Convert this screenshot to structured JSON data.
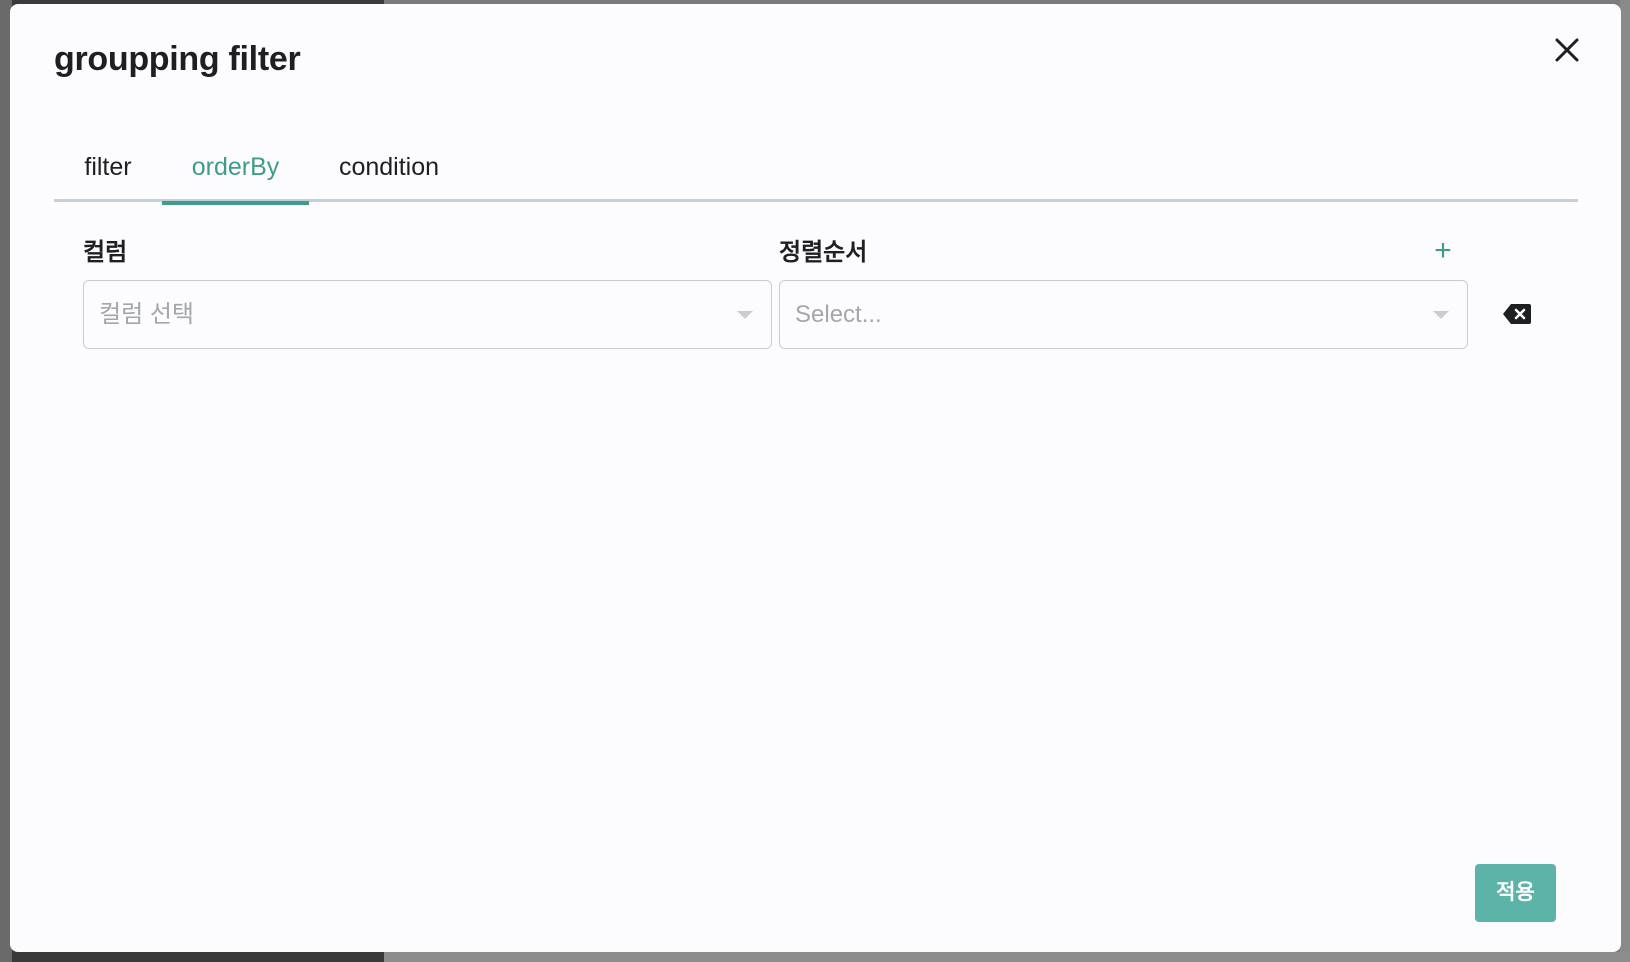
{
  "modal": {
    "title": "groupping filter",
    "close_icon": "close-icon"
  },
  "tabs": [
    {
      "label": "filter",
      "active": false
    },
    {
      "label": "orderBy",
      "active": true
    },
    {
      "label": "condition",
      "active": false
    }
  ],
  "order_by": {
    "column_label": "컬럼",
    "order_label": "정렬순서",
    "add_icon": "plus-icon",
    "add_symbol": "+",
    "rows": [
      {
        "column_placeholder": "컬럼 선택",
        "order_placeholder": "Select...",
        "delete_icon": "backspace-delete-icon"
      }
    ]
  },
  "footer": {
    "apply_label": "적용"
  },
  "colors": {
    "accent": "#3f9c8a",
    "apply_button": "#5cb3a8",
    "tab_underline": "#c5cfd9",
    "modal_bg": "#fcfcfe",
    "text": "#1e1f22",
    "placeholder": "#a3a6ab"
  }
}
